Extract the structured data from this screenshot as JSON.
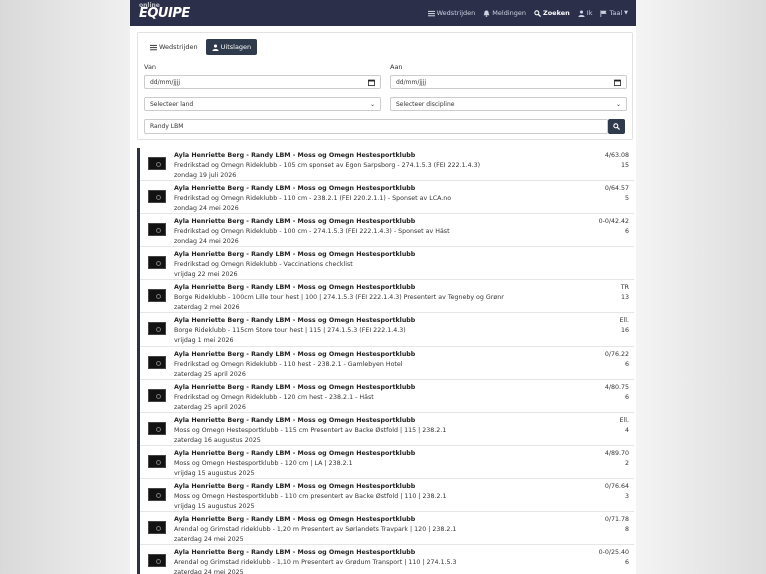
{
  "brand": {
    "name": "EQUIPE",
    "sub": "online"
  },
  "nav": {
    "competitions": "Wedstrijden",
    "notifications": "Meldingen",
    "search": "Zoeken",
    "me": "Ik",
    "language": "Taal"
  },
  "tabs": {
    "competitions": "Wedstrijden",
    "results": "Uitslagen"
  },
  "filters": {
    "from_label": "Van",
    "to_label": "Aan",
    "from_value": "dd/mm/jjjj",
    "to_value": "dd/mm/jjjj",
    "country": "Selecteer land",
    "discipline": "Selecteer discipline",
    "search_value": "Randy LBM"
  },
  "results": [
    {
      "title": "Ayla Henriette Berg - Randy LBM - Moss og Omegn Hestesportklubb",
      "event": "Fredrikstad og Omegn Rideklubb - 105 cm sponset av Egon Sarpsborg - 274.1.5.3 (FEI 222.1.4.3)",
      "date": "zondag 19 juli 2026",
      "score": "4/63.08",
      "place": "15"
    },
    {
      "title": "Ayla Henriette Berg - Randy LBM - Moss og Omegn Hestesportklubb",
      "event": "Fredrikstad og Omegn Rideklubb - 110 cm - 238.2.1 (FEI 220.2.1.1) - Sponset av LCA.no",
      "date": "zondag 24 mei 2026",
      "score": "0/64.57",
      "place": "5"
    },
    {
      "title": "Ayla Henriette Berg - Randy LBM - Moss og Omegn Hestesportklubb",
      "event": "Fredrikstad og Omegn Rideklubb - 100 cm - 274.1.5.3 (FEI 222.1.4.3) - Sponset av Häst",
      "date": "zondag 24 mei 2026",
      "score": "0-0/42.42",
      "place": "6"
    },
    {
      "title": "Ayla Henriette Berg - Randy LBM - Moss og Omegn Hestesportklubb",
      "event": "Fredrikstad og Omegn Rideklubb - Vaccinations checklist",
      "date": "vrijdag 22 mei 2026",
      "score": "",
      "place": ""
    },
    {
      "title": "Ayla Henriette Berg - Randy LBM - Moss og Omegn Hestesportklubb",
      "event": "Borge Rideklubb - 100cm Lille tour hest | 100 | 274.1.5.3 (FEI 222.1.4.3) Presentert av Tegneby og Grønnerø...",
      "date": "zaterdag 2 mei 2026",
      "score": "TR",
      "place": "13"
    },
    {
      "title": "Ayla Henriette Berg - Randy LBM - Moss og Omegn Hestesportklubb",
      "event": "Borge Rideklubb - 115cm Store tour hest | 115 | 274.1.5.3 (FEI 222.1.4.3)",
      "date": "vrijdag 1 mei 2026",
      "score": "Ell.",
      "place": "16"
    },
    {
      "title": "Ayla Henriette Berg - Randy LBM - Moss og Omegn Hestesportklubb",
      "event": "Fredrikstad og Omegn Rideklubb - 110 hest - 238.2.1 - Gamlebyen Hotel",
      "date": "zaterdag 25 april 2026",
      "score": "0/76.22",
      "place": "6"
    },
    {
      "title": "Ayla Henriette Berg - Randy LBM - Moss og Omegn Hestesportklubb",
      "event": "Fredrikstad og Omegn Rideklubb - 120 cm hest - 238.2.1 - Häst",
      "date": "zaterdag 25 april 2026",
      "score": "4/80.75",
      "place": "6"
    },
    {
      "title": "Ayla Henriette Berg - Randy LBM - Moss og Omegn Hestesportklubb",
      "event": "Moss og Omegn Hestesportklubb - 115 cm Presentert av Backe Østfold | 115 | 238.2.1",
      "date": "zaterdag 16 augustus 2025",
      "score": "Ell.",
      "place": "4"
    },
    {
      "title": "Ayla Henriette Berg - Randy LBM - Moss og Omegn Hestesportklubb",
      "event": "Moss og Omegn Hestesportklubb - 120 cm | LA | 238.2.1",
      "date": "vrijdag 15 augustus 2025",
      "score": "4/89.70",
      "place": "2"
    },
    {
      "title": "Ayla Henriette Berg - Randy LBM - Moss og Omegn Hestesportklubb",
      "event": "Moss og Omegn Hestesportklubb - 110 cm presentert av Backe Østfold | 110 | 238.2.1",
      "date": "vrijdag 15 augustus 2025",
      "score": "0/76.64",
      "place": "3"
    },
    {
      "title": "Ayla Henriette Berg - Randy LBM - Moss og Omegn Hestesportklubb",
      "event": "Arendal og Grimstad rideklubb - 1,20 m Presentert av Sørlandets Travpark | 120 | 238.2.1",
      "date": "zaterdag 24 mei 2025",
      "score": "0/71.78",
      "place": "8"
    },
    {
      "title": "Ayla Henriette Berg - Randy LBM - Moss og Omegn Hestesportklubb",
      "event": "Arendal og Grimstad rideklubb - 1,10 m Presentert av Grødum Transport | 110 | 274.1.5.3",
      "date": "zaterdag 24 mei 2025",
      "score": "0-0/25.40",
      "place": "6"
    }
  ]
}
